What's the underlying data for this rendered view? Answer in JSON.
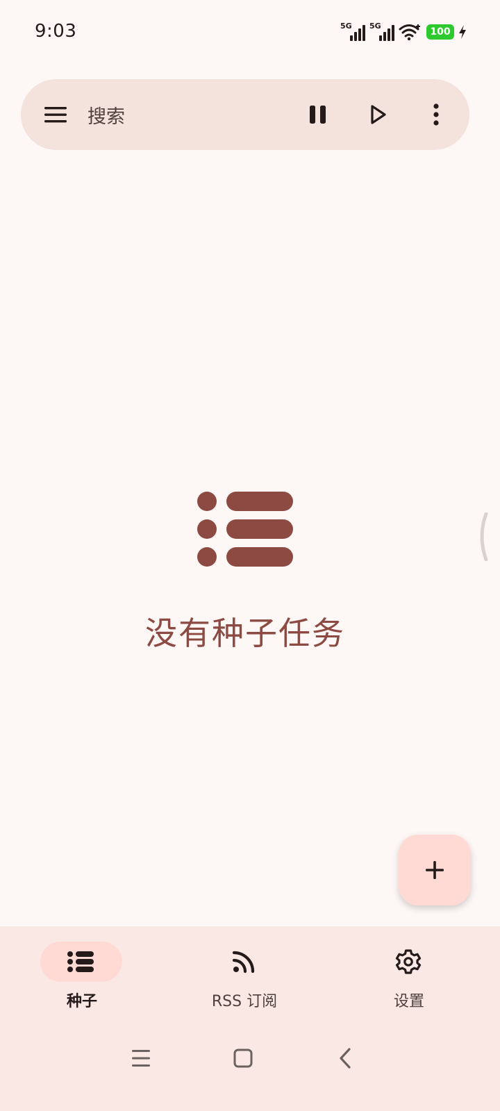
{
  "status_bar": {
    "time": "9:03",
    "signal_1_label": "5G",
    "signal_2_label": "5G",
    "battery": "100"
  },
  "search_bar": {
    "placeholder": "搜索",
    "icons": [
      "menu-icon",
      "pause-icon",
      "play-icon",
      "more-vert-icon"
    ]
  },
  "empty_state": {
    "icon": "list-icon",
    "message": "没有种子任务"
  },
  "fab": {
    "icon": "add-icon"
  },
  "bottom_nav": {
    "items": [
      {
        "label": "种子",
        "icon": "list-icon",
        "active": true
      },
      {
        "label": "RSS 订阅",
        "icon": "rss-icon",
        "active": false
      },
      {
        "label": "设置",
        "icon": "gear-icon",
        "active": false
      }
    ]
  },
  "system_nav": [
    "recents-icon",
    "home-icon",
    "back-icon"
  ],
  "colors": {
    "background": "#fdf7f5",
    "search_bar": "#f4e2dd",
    "accent": "#8c4a43",
    "fab": "#ffdad5",
    "nav_background": "#fae8e4",
    "battery": "#2ec92e"
  }
}
